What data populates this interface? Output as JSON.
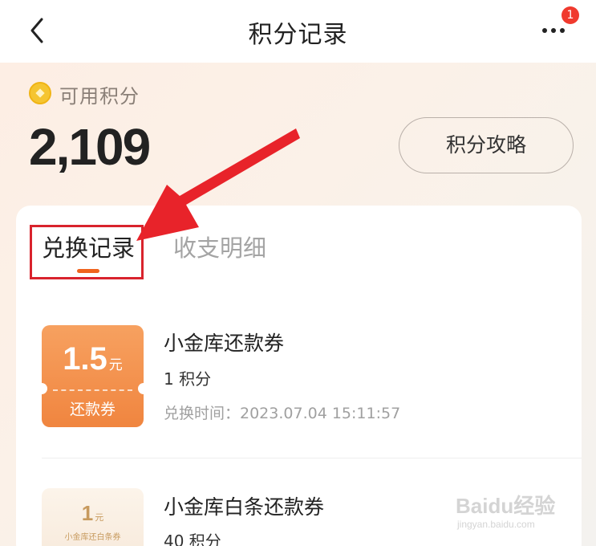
{
  "header": {
    "title": "积分记录",
    "badge_count": "1"
  },
  "summary": {
    "label": "可用积分",
    "value": "2,109",
    "guide_button": "积分攻略"
  },
  "tabs": [
    {
      "label": "兑换记录",
      "active": true
    },
    {
      "label": "收支明细",
      "active": false
    }
  ],
  "records": [
    {
      "coupon_amount": "1.5",
      "coupon_unit": "元",
      "coupon_type": "还款券",
      "title": "小金库还款券",
      "points": "1 积分",
      "time": "兑换时间：2023.07.04 15:11:57"
    },
    {
      "coupon_amount": "1",
      "coupon_unit": "元",
      "coupon_type": "小金库还白条券",
      "title": "小金库白条还款券",
      "points": "40 积分"
    }
  ],
  "watermark": {
    "main": "Baidu经验",
    "sub": "jingyan.baidu.com"
  },
  "colors": {
    "accent": "#f0641e",
    "badge": "#f03a2e",
    "annotation": "#d9232d",
    "coupon": "#f0853f"
  }
}
